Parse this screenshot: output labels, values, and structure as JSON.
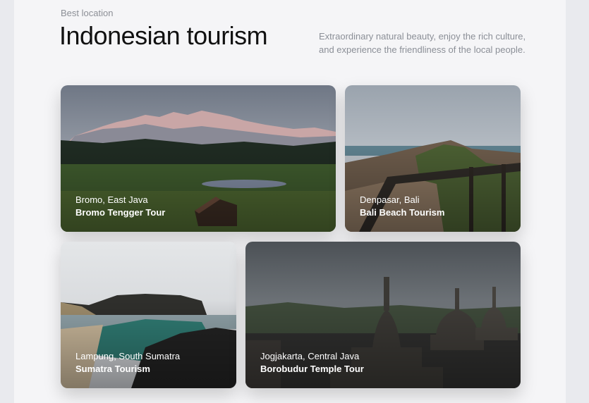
{
  "header": {
    "kicker": "Best location",
    "title": "Indonesian tourism",
    "description": "Extraordinary natural beauty, enjoy the rich culture, and experience the friendliness of the local people."
  },
  "cards": [
    {
      "location": "Bromo, East Java",
      "name": "Bromo Tengger Tour"
    },
    {
      "location": "Denpasar, Bali",
      "name": "Bali Beach Tourism"
    },
    {
      "location": "Lampung, South Sumatra",
      "name": "Sumatra Tourism"
    },
    {
      "location": "Jogjakarta, Central Java",
      "name": "Borobudur Temple Tour"
    }
  ]
}
